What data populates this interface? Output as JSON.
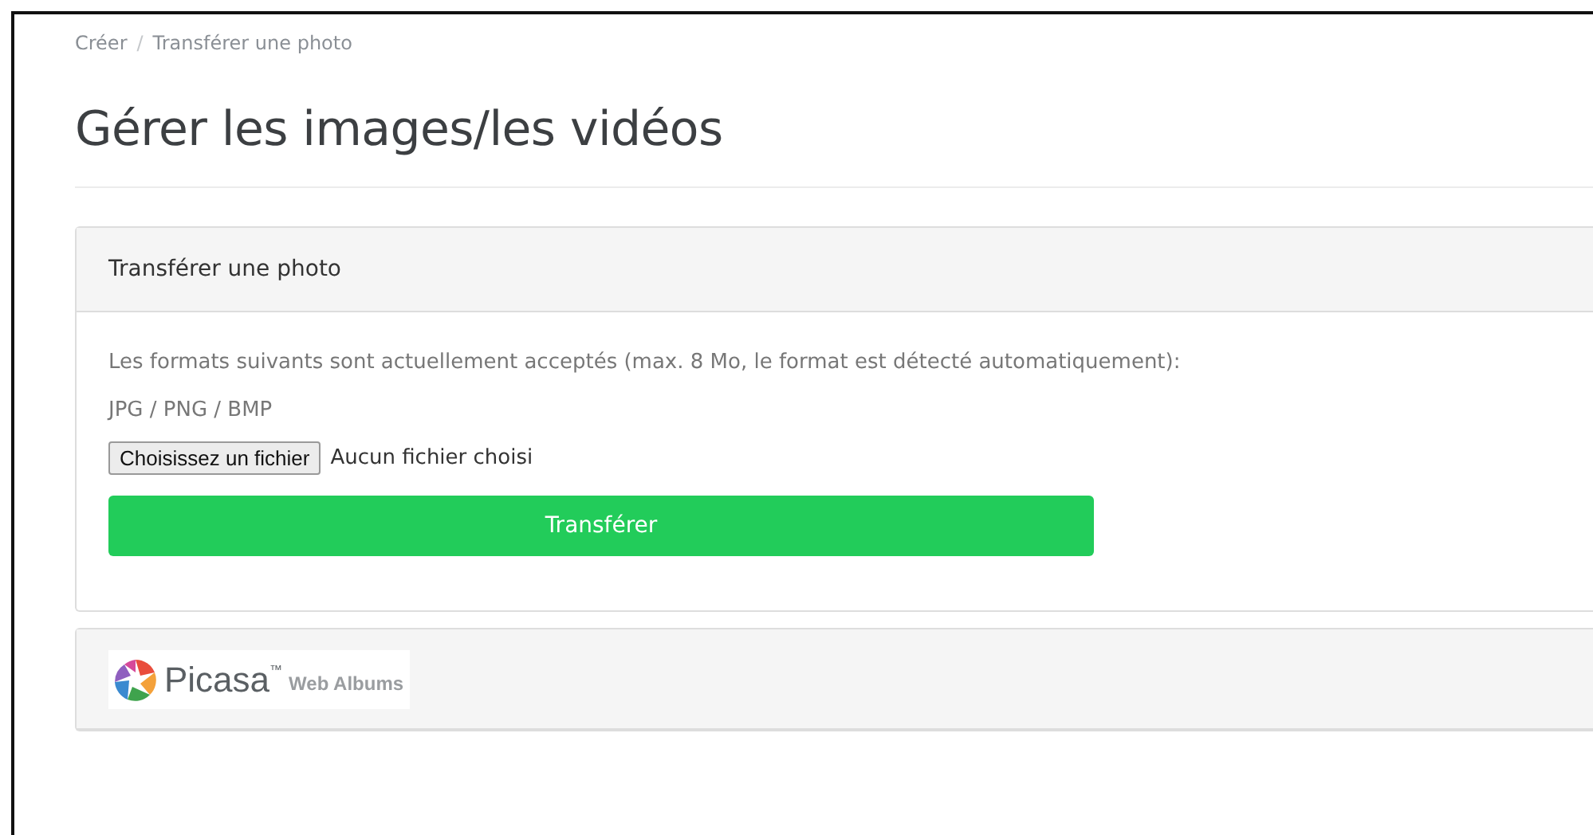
{
  "breadcrumb": [
    {
      "label": "Créer"
    },
    {
      "label": "Transférer une photo"
    }
  ],
  "breadcrumb_separator": "/",
  "title": "Gérer les images/les vidéos",
  "upload_panel": {
    "heading": "Transférer une photo",
    "formats_note": "Les formats suivants sont actuellement acceptés (max. 8 Mo, le format est détecté automatiquement):",
    "formats": "JPG / PNG / BMP",
    "file_button": "Choisissez un fichier",
    "file_status": "Aucun fichier choisi",
    "submit": "Transférer"
  },
  "picasa_panel": {
    "logo_name": "Picasa",
    "logo_mark": "™",
    "logo_sub": "Web Albums"
  }
}
